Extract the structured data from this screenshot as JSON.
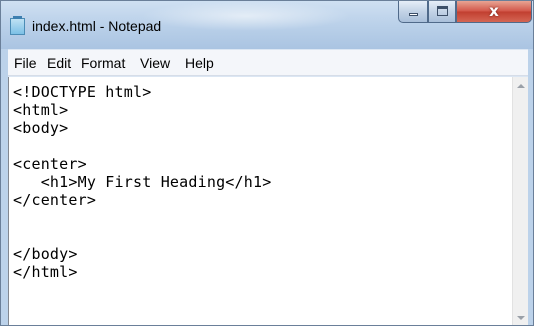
{
  "window": {
    "title": "index.html - Notepad",
    "controls": {
      "minimize": "minimize",
      "maximize": "maximize",
      "close_glyph": "x"
    }
  },
  "menu": [
    "File",
    "Edit",
    "Format",
    "View",
    "Help"
  ],
  "editor": {
    "lines": [
      "<!DOCTYPE html>",
      "<html>",
      "<body>",
      "",
      "<center>",
      "   <h1>My First Heading</h1>",
      "</center>",
      "",
      "",
      "</body>",
      "</html>"
    ]
  },
  "colors": {
    "titlebar": "#bcd2ea",
    "close_button": "#c94d3e",
    "editor_background": "#ffffff"
  },
  "icons": {
    "app": "notepad-icon",
    "scroll_up": "scroll-up-arrow-icon",
    "scroll_down": "scroll-down-arrow-icon"
  }
}
